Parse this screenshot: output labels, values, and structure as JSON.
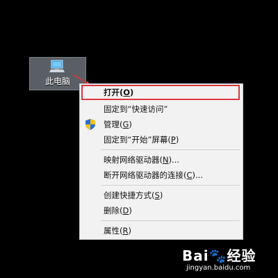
{
  "desktop": {
    "icon": {
      "label": "此电脑",
      "icon_name": "computer-icon"
    }
  },
  "context_menu": {
    "items": [
      {
        "label": "打开(",
        "mnemonic": "O",
        "suffix": ")"
      },
      {
        "label": "固定到“快速访问”",
        "mnemonic": "",
        "suffix": ""
      },
      {
        "label": "管理(",
        "mnemonic": "G",
        "suffix": ")",
        "icon_name": "uac-shield-icon"
      },
      {
        "label": "固定到“开始”屏幕(",
        "mnemonic": "P",
        "suffix": ")"
      },
      {
        "label": "映射网络驱动器(",
        "mnemonic": "N",
        "suffix": ")..."
      },
      {
        "label": "断开网络驱动器的连接(",
        "mnemonic": "C",
        "suffix": ")..."
      },
      {
        "label": "创建快捷方式(",
        "mnemonic": "S",
        "suffix": ")"
      },
      {
        "label": "删除(",
        "mnemonic": "D",
        "suffix": ")"
      },
      {
        "label": "属性(",
        "mnemonic": "R",
        "suffix": ")"
      }
    ],
    "highlight_color": "#d9363e"
  },
  "watermark": {
    "brand": "Bai",
    "brand_mid": "🐾",
    "brand_end": "经验",
    "url": "jingyan.baidu.com"
  }
}
